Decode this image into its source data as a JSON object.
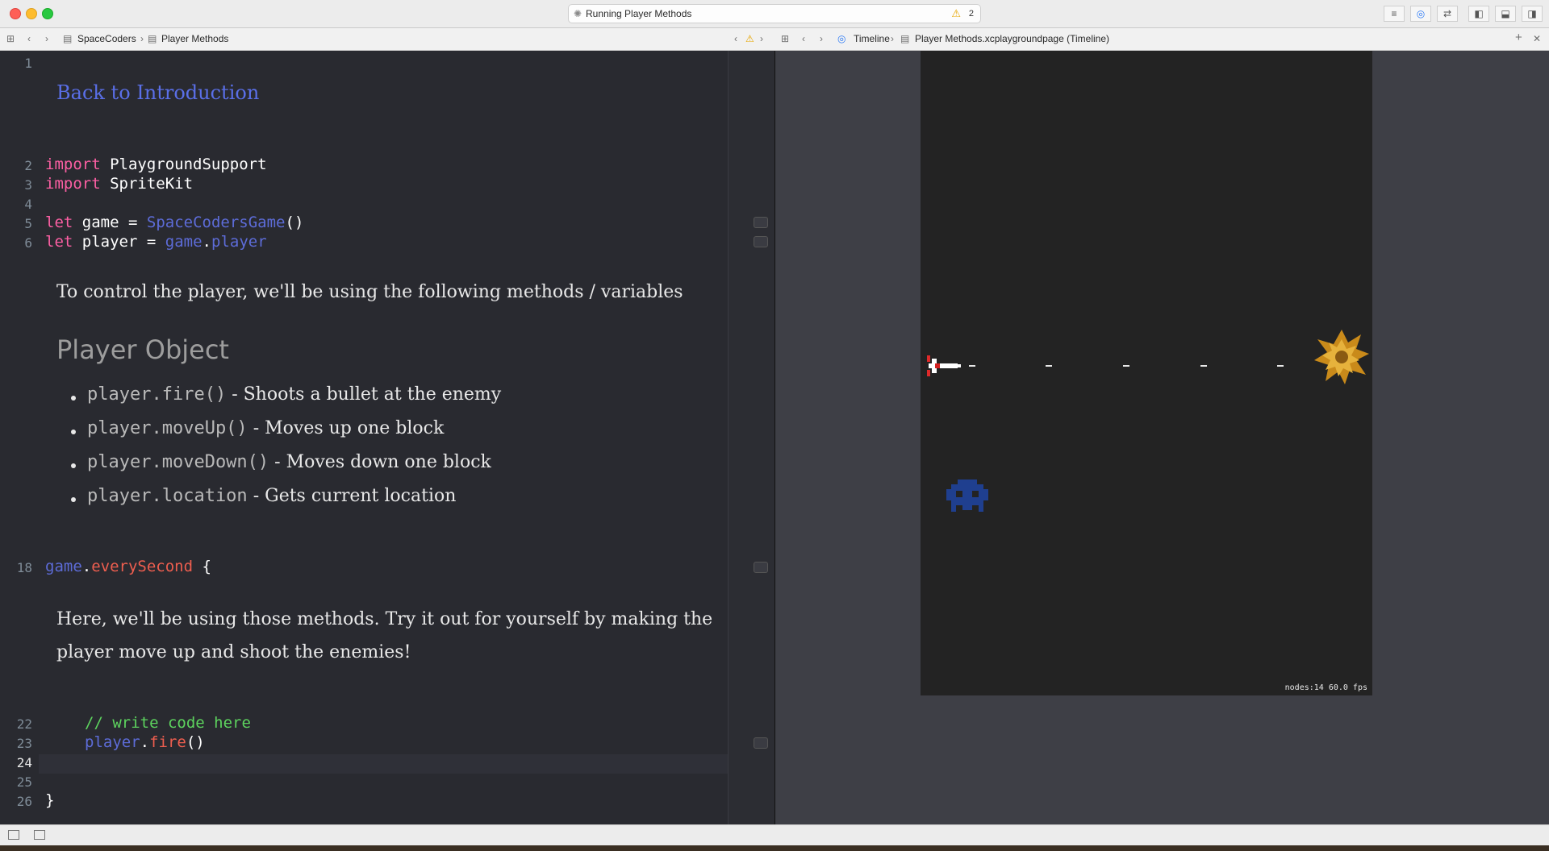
{
  "window": {
    "status": "Running Player Methods",
    "warning_count": "2"
  },
  "editor_jumpbar": {
    "project": "SpaceCoders",
    "page": "Player Methods"
  },
  "assistant_jumpbar": {
    "mode": "Timeline",
    "file": "Player Methods.xcplaygroundpage (Timeline)"
  },
  "editor": {
    "line_numbers": [
      "1",
      "2",
      "3",
      "4",
      "5",
      "6",
      "18",
      "22",
      "23",
      "24",
      "25",
      "26"
    ],
    "back_link": "Back to Introduction",
    "intro_text": "To control the player, we'll be using the following methods / variables",
    "heading": "Player Object",
    "methods": [
      {
        "code": "player.fire()",
        "desc": "- Shoots a bullet at the enemy"
      },
      {
        "code": "player.moveUp()",
        "desc": "- Moves up one block"
      },
      {
        "code": "player.moveDown()",
        "desc": "- Moves down one block"
      },
      {
        "code": "player.location",
        "desc": "- Gets current location"
      }
    ],
    "instructions_line1": "Here, we'll be using those methods. Try it out for yourself by making the",
    "instructions_line2": "player move up and shoot the enemies!",
    "code": {
      "import1_kw": "import",
      "import1_mod": "PlaygroundSupport",
      "import2_kw": "import",
      "import2_mod": "SpriteKit",
      "let_kw": "let",
      "game_var": "game",
      "game_type": "SpaceCodersGame",
      "player_var": "player",
      "game_ref": "game",
      "player_prop": "player",
      "loop_obj": "game",
      "loop_fn": "everySecond",
      "comment": "// write code here",
      "call_obj": "player",
      "call_fn": "fire",
      "open_brace": "{",
      "close_brace": "}",
      "eq": "=",
      "parens": "()",
      "dot": "."
    }
  },
  "game_scene": {
    "stats": "nodes:14  60.0 fps"
  },
  "colors": {
    "keyword": "#fc5fa3",
    "type": "#5d6cd8",
    "function": "#ee5e4f",
    "comment": "#5dd35e",
    "link": "#5a6fe8",
    "editor_bg": "#292a30"
  }
}
